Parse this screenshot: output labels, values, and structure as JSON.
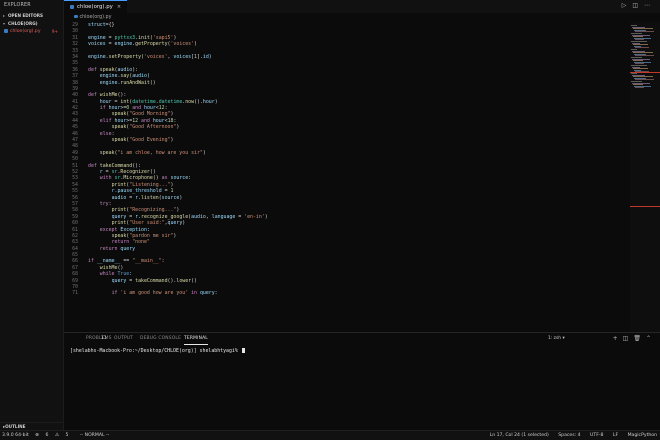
{
  "sidebar": {
    "title": "EXPLORER",
    "open_editors": "OPEN EDITORS",
    "folder": "CHLOE(ORG)",
    "file": {
      "name": "chloe(org).py",
      "badge": "9+"
    },
    "outline": "OUTLINE"
  },
  "tab": {
    "name": "chloe(org).py"
  },
  "breadcrumb": "chloe(org).py",
  "editor": {
    "lines": [
      {
        "n": "29",
        "t": "struct={}"
      },
      {
        "n": "30",
        "t": ""
      },
      {
        "n": "31",
        "t": "engine = pyttsx3.init('sapi5')"
      },
      {
        "n": "32",
        "t": "voices = engine.getProperty('voices')"
      },
      {
        "n": "33",
        "t": ""
      },
      {
        "n": "34",
        "t": "engine.setProperty('voices', voices[1].id)"
      },
      {
        "n": "35",
        "t": ""
      },
      {
        "n": "36",
        "t": "def speak(audio):"
      },
      {
        "n": "37",
        "t": "    engine.say(audio)"
      },
      {
        "n": "38",
        "t": "    engine.runAndWait()"
      },
      {
        "n": "39",
        "t": ""
      },
      {
        "n": "40",
        "t": "def wishMe():"
      },
      {
        "n": "41",
        "t": "    hour = int(datetime.datetime.now().hour)"
      },
      {
        "n": "42",
        "t": "    if hour>=0 and hour<12:"
      },
      {
        "n": "43",
        "t": "        speak(\"Good Morning\")"
      },
      {
        "n": "44",
        "t": "    elif hour>=12 and hour<18:"
      },
      {
        "n": "45",
        "t": "        speak(\"Good Afternoon\")"
      },
      {
        "n": "46",
        "t": "    else:"
      },
      {
        "n": "47",
        "t": "        speak(\"Good Evening\")"
      },
      {
        "n": "48",
        "t": ""
      },
      {
        "n": "49",
        "t": "    speak(\"i am chloe, how are you sir\")"
      },
      {
        "n": "50",
        "t": ""
      },
      {
        "n": "51",
        "t": "def takeCommand():"
      },
      {
        "n": "52",
        "t": "    r = sr.Recognizer()"
      },
      {
        "n": "53",
        "t": "    with sr.Microphone() as source:"
      },
      {
        "n": "54",
        "t": "        print(\"Listening...\")"
      },
      {
        "n": "55",
        "t": "        r.pause_threshold = 1"
      },
      {
        "n": "56",
        "t": "        audio = r.listen(source)"
      },
      {
        "n": "57",
        "t": "    try:"
      },
      {
        "n": "58",
        "t": "        print(\"Recognizing...\")"
      },
      {
        "n": "59",
        "t": "        query = r.recognize_google(audio, language = 'en-in')"
      },
      {
        "n": "60",
        "t": "        print(\"User said:\",query)"
      },
      {
        "n": "61",
        "t": "    except Exception:"
      },
      {
        "n": "62",
        "t": "        speak(\"pardon me sir\")"
      },
      {
        "n": "63",
        "t": "        return \"none\""
      },
      {
        "n": "64",
        "t": "    return query"
      },
      {
        "n": "65",
        "t": ""
      },
      {
        "n": "66",
        "t": "if __name__ == \"__main__\":"
      },
      {
        "n": "67",
        "t": "    wishMe()"
      },
      {
        "n": "68",
        "t": "    while True:"
      },
      {
        "n": "69",
        "t": "        query = takeCommand().lower()"
      },
      {
        "n": "70",
        "t": ""
      },
      {
        "n": "71",
        "t": "        if 'i am good how are you' in query:"
      }
    ]
  },
  "panel": {
    "tabs": [
      "PROBLEMS",
      "OUTPUT",
      "DEBUG CONSOLE",
      "TERMINAL"
    ],
    "problems_count": "11",
    "active_tab": "TERMINAL",
    "terminal_selector": "1: zsh",
    "terminal_text": "[shelabhs-Macbook-Pro:~/Desktop/CHLOE(org)] shelabhtyagi% "
  },
  "statusbar": {
    "python": "3.9.0 64-bit",
    "errors": "6",
    "warnings": "5",
    "mode": "-- NORMAL --",
    "position": "Ln 17, Col 24 (1 selected)",
    "spaces": "Spaces: 4",
    "encoding": "UTF-8",
    "eol": "LF",
    "language": "MagicPython"
  },
  "colors": {
    "background": "#0b0b0b",
    "accent": "#4a9eff",
    "error": "#e0605a",
    "keyword": "#c586c0",
    "string": "#ce9178",
    "function": "#dcdcaa"
  }
}
